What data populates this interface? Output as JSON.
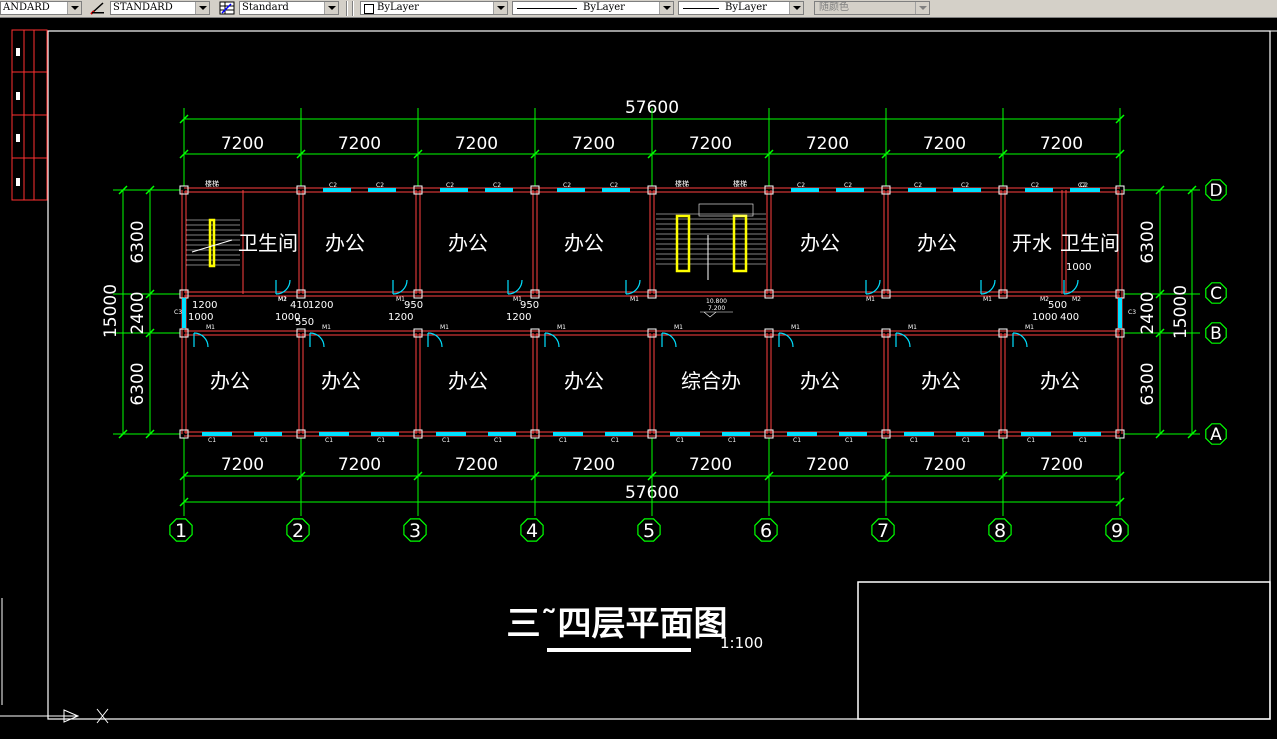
{
  "toolbar": {
    "text_style": "ANDARD",
    "dim_style": "STANDARD",
    "table_style": "Standard",
    "layer": "ByLayer",
    "linetype": "ByLayer",
    "lineweight": "ByLayer",
    "plot_style": "随颜色"
  },
  "drawing": {
    "total_dim": "57600",
    "bay_dim": "7200",
    "width_dims": {
      "outer": "15000",
      "bay_a": "6300",
      "corridor": "2400",
      "bay_b": "6300"
    },
    "grid_cols": [
      "1",
      "2",
      "3",
      "4",
      "5",
      "6",
      "7",
      "8",
      "9"
    ],
    "grid_rows": [
      "D",
      "C",
      "B",
      "A"
    ],
    "rooms_top": [
      "卫生间",
      "办公",
      "办公",
      "办公",
      "办公",
      "办公",
      "开水",
      "卫生间"
    ],
    "rooms_bottom": [
      "办公",
      "办公",
      "办公",
      "办公",
      "综合办",
      "办公",
      "办公",
      "办公"
    ],
    "title": "三˜四层平面图",
    "scale": "1:100",
    "small_dims": {
      "d1200": "1200",
      "d1000": "1000",
      "d950": "950",
      "d550": "550",
      "d410": "410",
      "d500": "500",
      "d400": "400"
    },
    "level": {
      "a": "10.800",
      "b": "7.200"
    },
    "labels": {
      "window_c2": "C2",
      "window_c1": "C1",
      "door_m1": "M1",
      "door_m2": "M2",
      "c3": "C3",
      "stair": "楼梯"
    }
  },
  "colors": {
    "bg": "#000000",
    "dim": "#00ff00",
    "wall": "#ff4040",
    "window": "#00e0ff",
    "text": "#ffffff",
    "stair": "#ffff00",
    "frame": "#ffffff"
  }
}
